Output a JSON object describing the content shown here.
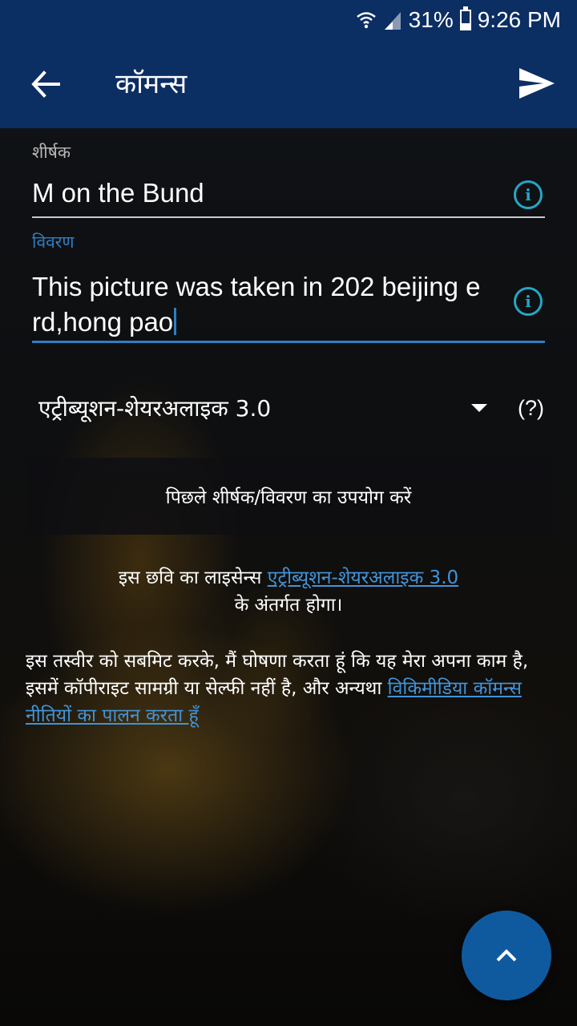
{
  "status_bar": {
    "battery": "31%",
    "time": "9:26 PM",
    "battery_level": 0.31,
    "icons": [
      "wifi-icon",
      "signal-icon",
      "battery-icon"
    ]
  },
  "app_bar": {
    "title": "कॉमन्स",
    "back_icon": "back-arrow-icon",
    "send_icon": "send-icon"
  },
  "form": {
    "title_label": "शीर्षक",
    "title_value": "M on the Bund",
    "description_label": "विवरण",
    "description_value": "This picture was taken in 202 beijing e rd,hong pao",
    "license_selected": "एट्रीब्यूशन-शेयरअलाइक 3.0",
    "help_link": "(?)",
    "previous_button": "पिछले शीर्षक/विवरण का उपयोग करें"
  },
  "license_notice": {
    "prefix": "इस छवि का लाइसेन्स ",
    "license_link": "एट्रीब्यूशन-शेयरअलाइक 3.0",
    "suffix": "के अंतर्गत होगा।"
  },
  "declaration": {
    "text": "इस तस्वीर को सबमिट करके, मैं घोषणा करता हूं कि यह मेरा अपना काम है, इसमें कॉपीराइट सामग्री या सेल्फी नहीं है, और अन्यथा ",
    "policy_link": "विकिमीडिया कॉमन्स नीतियों का पालन करता हूँ"
  },
  "colors": {
    "primary": "#0b2e63",
    "accent": "#2f7ec3",
    "fab": "#0f5a9f",
    "info": "#26a6c4"
  }
}
